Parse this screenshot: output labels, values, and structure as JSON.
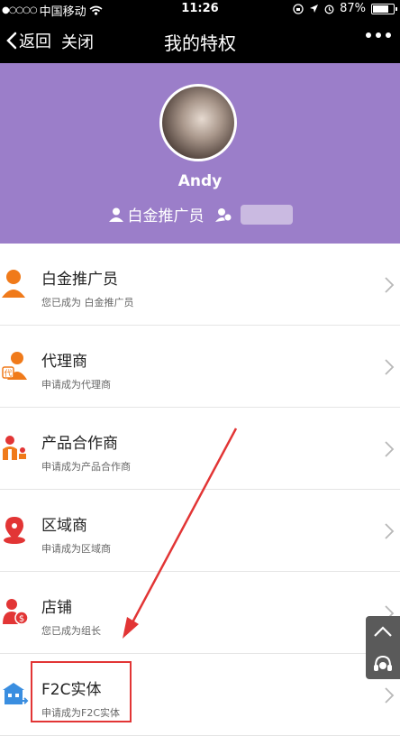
{
  "status_bar": {
    "carrier": "中国移动",
    "time": "11:26",
    "battery": "87%",
    "battery_level": 0.87
  },
  "nav": {
    "back_label": "返回",
    "close_label": "关闭",
    "title": "我的特权"
  },
  "profile": {
    "name": "Andy",
    "level": "白金推广员"
  },
  "items": [
    {
      "label": "白金推广员",
      "sub": "您已成为 白金推广员",
      "icon": "person-icon"
    },
    {
      "label": "代理商",
      "sub": "申请成为代理商",
      "icon": "agent-icon"
    },
    {
      "label": "产品合作商",
      "sub": "申请成为产品合作商",
      "icon": "partner-icon"
    },
    {
      "label": "区域商",
      "sub": "申请成为区域商",
      "icon": "region-icon"
    },
    {
      "label": "店铺",
      "sub": "您已成为组长",
      "icon": "shop-icon"
    },
    {
      "label": "F2C实体",
      "sub": "申请成为F2C实体",
      "icon": "f2c-icon"
    }
  ],
  "colors": {
    "header_bg": "#9b7ec9",
    "accent_orange": "#f07a1a",
    "accent_red": "#e23535",
    "highlight": "#e23535"
  }
}
